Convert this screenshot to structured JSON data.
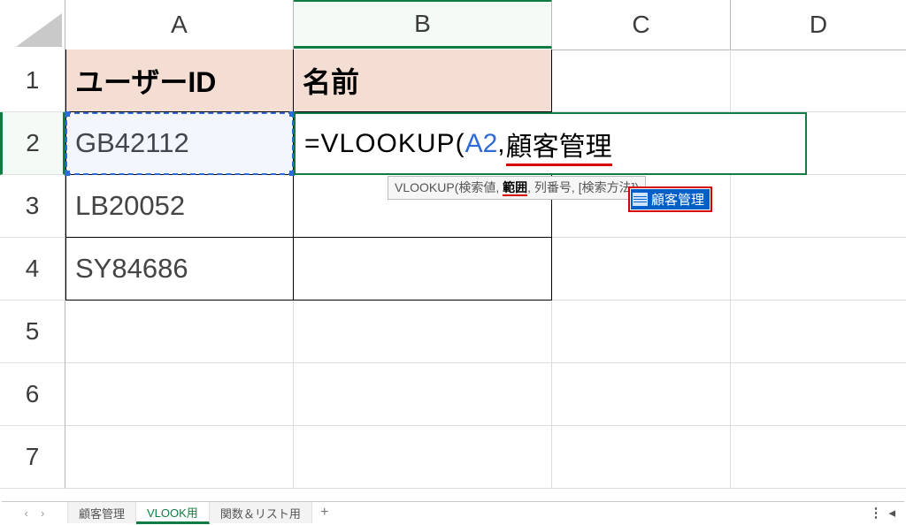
{
  "columns": {
    "A": "A",
    "B": "B",
    "C": "C",
    "D": "D"
  },
  "rows": {
    "r1": "1",
    "r2": "2",
    "r3": "3",
    "r4": "4",
    "r5": "5",
    "r6": "6",
    "r7": "7"
  },
  "header_cells": {
    "A1": "ユーザーID",
    "B1": "名前"
  },
  "data_cells": {
    "A2": "GB42112",
    "A3": "LB20052",
    "A4": "SY84686"
  },
  "edit_cell": {
    "address": "B2",
    "formula_prefix": "=VLOOKUP(",
    "ref_token": "A2",
    "sep": ",",
    "name_token": "顧客管理"
  },
  "fn_tooltip": {
    "fn": "VLOOKUP(",
    "a1": "検索値",
    "a2": "範囲",
    "a3": "列番号",
    "a4": "[検索方法]",
    "close": ")"
  },
  "suggestion": {
    "label": "顧客管理"
  },
  "tabs": {
    "nav_prev": "‹",
    "nav_next": "›",
    "t1": "顧客管理",
    "t2": "VLOOK用",
    "t3": "関数＆リスト用",
    "add": "+",
    "kebab": "⋮",
    "resize": "◂"
  }
}
